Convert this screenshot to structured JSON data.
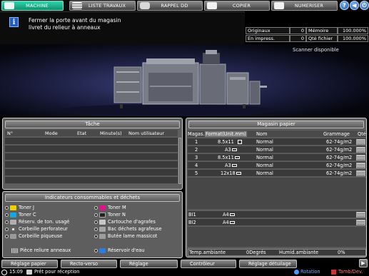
{
  "tabs": [
    {
      "label": "MACHINE",
      "active": true
    },
    {
      "label": "LISTE TRAVAUX"
    },
    {
      "label": "RAPPEL DD"
    },
    {
      "label": "COPIER"
    },
    {
      "label": "NUMERISER"
    }
  ],
  "icons": {
    "help": "?",
    "back": "◀",
    "power": "⏻"
  },
  "message": {
    "line1": "Fermer la porte avant du magasin",
    "line2": "livret du relieur à anneaux"
  },
  "counters": {
    "originaux_label": "Originaux",
    "originaux_val": "0",
    "memoire_label": "Mémoire",
    "memoire_val": "100.000%",
    "impress_label": "En impress.",
    "impress_val": "0",
    "qte_label": "Qté fichier",
    "qte_val": "100.000%"
  },
  "machine_status": "Scanner disponible",
  "tache": {
    "title": "Tâche",
    "headers": [
      "N°",
      "Mode",
      "Etat",
      "Minute(s)",
      "Nom utilisateur"
    ]
  },
  "consumables": {
    "title": "Indicateurs consommables et déchets",
    "left": [
      "Toner J",
      "Toner C",
      "Réserv. de ton. usagé",
      "Corbeille perforateur",
      "Corbeille piqueuse"
    ],
    "right": [
      "Toner M",
      "Toner N",
      "Cartouche d'agrafes",
      "Bac déchets agrafeuse",
      "Butée lame massicot"
    ],
    "bottom_left": "Pièce reliure anneaux",
    "bottom_right": "Réservoir d'eau"
  },
  "paper": {
    "title": "Magasin papier",
    "headers": [
      "Magas.",
      "Format(Unit.mm)",
      "Nom",
      "Grammage",
      "Qté"
    ],
    "rows": [
      {
        "tray": "1",
        "format": "8.5x11",
        "name": "Normal",
        "weight": "62-74g/m2"
      },
      {
        "tray": "2",
        "format": "A3",
        "name": "Normal",
        "weight": "62-74g/m2"
      },
      {
        "tray": "3",
        "format": "8.5x11",
        "name": "Normal",
        "weight": "62-74g/m2"
      },
      {
        "tray": "4",
        "format": "A3",
        "name": "Normal",
        "weight": "62-74g/m2"
      },
      {
        "tray": "5",
        "format": "12x18",
        "name": "Normal",
        "weight": "62-74g/m2"
      }
    ],
    "bypass": [
      {
        "tray": "BI1",
        "format": "A4"
      },
      {
        "tray": "BI2",
        "format": "A4"
      }
    ],
    "temp_label": "Temp.ambiante",
    "temp_val": "0Degrés",
    "hum_label": "Humid.ambiante",
    "hum_val": "0%"
  },
  "bottom_buttons": [
    "Réglage papier",
    "Recto-verso",
    "Réglage",
    "Contrôleur",
    "Réglage détuilage"
  ],
  "footer": {
    "time": "15:09",
    "status": "Prêt pour réception",
    "rotation": "Rotation",
    "tamb": "Tamb/Dev."
  },
  "colors": {
    "active_tab": "#1db58e",
    "info_blue": "#1f5fc0",
    "panel_gray": "#5e5e5e"
  }
}
